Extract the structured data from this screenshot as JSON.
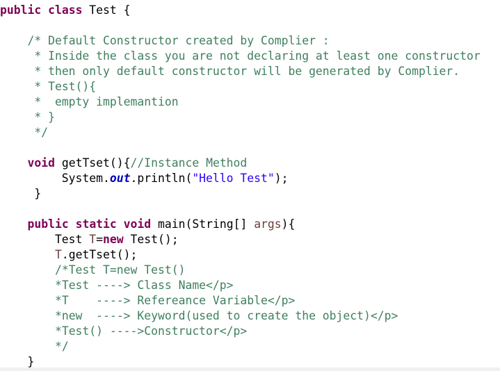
{
  "editor": {
    "lines": [
      [
        {
          "t": "kw",
          "s": "public"
        },
        {
          "t": "pl",
          "s": " "
        },
        {
          "t": "kw",
          "s": "class"
        },
        {
          "t": "pl",
          "s": " Test {"
        }
      ],
      [],
      [
        {
          "t": "pl",
          "s": "    "
        },
        {
          "t": "cm",
          "s": "/* Default Constructor created by Complier :"
        }
      ],
      [
        {
          "t": "pl",
          "s": "     "
        },
        {
          "t": "cm",
          "s": "* Inside the class you are not declaring at least one constructor"
        }
      ],
      [
        {
          "t": "pl",
          "s": "     "
        },
        {
          "t": "cm",
          "s": "* then only default constructor will be generated by Complier."
        }
      ],
      [
        {
          "t": "pl",
          "s": "     "
        },
        {
          "t": "cm",
          "s": "* Test(){"
        }
      ],
      [
        {
          "t": "pl",
          "s": "     "
        },
        {
          "t": "cm",
          "s": "*  empty implemantion"
        }
      ],
      [
        {
          "t": "pl",
          "s": "     "
        },
        {
          "t": "cm",
          "s": "* }"
        }
      ],
      [
        {
          "t": "pl",
          "s": "     "
        },
        {
          "t": "cm",
          "s": "*/"
        }
      ],
      [],
      [
        {
          "t": "pl",
          "s": "    "
        },
        {
          "t": "kw",
          "s": "void"
        },
        {
          "t": "pl",
          "s": " getTset(){"
        },
        {
          "t": "cm",
          "s": "//Instance Method"
        }
      ],
      [
        {
          "t": "pl",
          "s": "         System."
        },
        {
          "t": "fld",
          "s": "out"
        },
        {
          "t": "pl",
          "s": ".println("
        },
        {
          "t": "str",
          "s": "\"Hello Test\""
        },
        {
          "t": "pl",
          "s": ");"
        }
      ],
      [
        {
          "t": "pl",
          "s": "     }"
        }
      ],
      [],
      [
        {
          "t": "pl",
          "s": "    "
        },
        {
          "t": "kw",
          "s": "public"
        },
        {
          "t": "pl",
          "s": " "
        },
        {
          "t": "kw",
          "s": "static"
        },
        {
          "t": "pl",
          "s": " "
        },
        {
          "t": "kw",
          "s": "void"
        },
        {
          "t": "pl",
          "s": " main(String[] "
        },
        {
          "t": "var",
          "s": "args"
        },
        {
          "t": "pl",
          "s": "){"
        }
      ],
      [
        {
          "t": "pl",
          "s": "        Test "
        },
        {
          "t": "var",
          "s": "T"
        },
        {
          "t": "pl",
          "s": "="
        },
        {
          "t": "kw",
          "s": "new"
        },
        {
          "t": "pl",
          "s": " Test();"
        }
      ],
      [
        {
          "t": "pl",
          "s": "        "
        },
        {
          "t": "var",
          "s": "T"
        },
        {
          "t": "pl",
          "s": ".getTset();"
        }
      ],
      [
        {
          "t": "pl",
          "s": "        "
        },
        {
          "t": "cm",
          "s": "/*Test T=new Test()"
        }
      ],
      [
        {
          "t": "pl",
          "s": "        "
        },
        {
          "t": "cm",
          "s": "*Test ----> Class Name</p>"
        }
      ],
      [
        {
          "t": "pl",
          "s": "        "
        },
        {
          "t": "cm",
          "s": "*T    ----> Refereance Variable</p>"
        }
      ],
      [
        {
          "t": "pl",
          "s": "        "
        },
        {
          "t": "cm",
          "s": "*new  ----> Keyword(used to create the object)</p>"
        }
      ],
      [
        {
          "t": "pl",
          "s": "        "
        },
        {
          "t": "cm",
          "s": "*Test() ---->Constructor</p>"
        }
      ],
      [
        {
          "t": "pl",
          "s": "        "
        },
        {
          "t": "cm",
          "s": "*/"
        }
      ],
      [
        {
          "t": "pl",
          "s": "    }"
        }
      ]
    ]
  },
  "colors": {
    "keyword": "#7f0055",
    "comment": "#3f7f5f",
    "string": "#2a00ff",
    "static_field": "#0000c0",
    "local_variable": "#6a3e3e",
    "plain": "#000000",
    "background": "#ffffff"
  }
}
